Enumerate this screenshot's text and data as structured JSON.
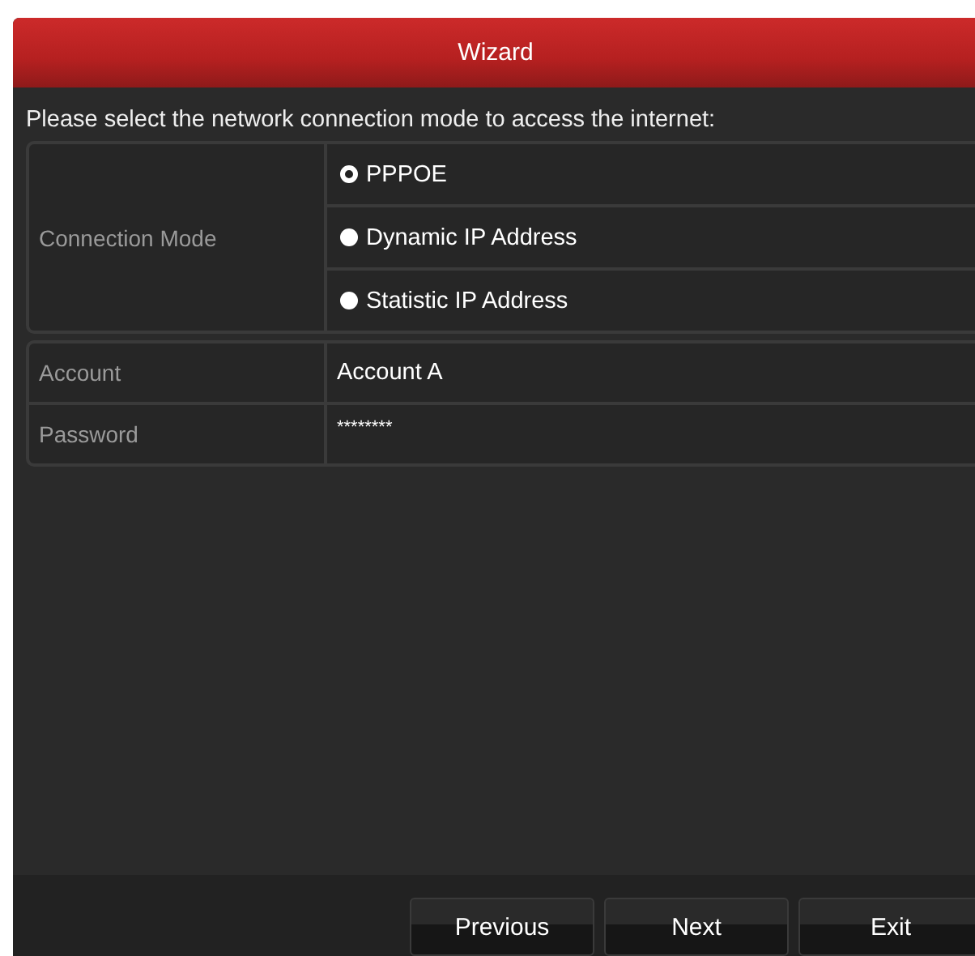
{
  "window": {
    "title": "Wizard"
  },
  "prompt": "Please select the network connection mode to access the internet:",
  "connection_mode": {
    "label": "Connection Mode",
    "options": [
      {
        "label": "PPPOE",
        "selected": true
      },
      {
        "label": "Dynamic IP Address",
        "selected": false
      },
      {
        "label": "Statistic IP Address",
        "selected": false
      }
    ]
  },
  "fields": [
    {
      "label": "Account",
      "value": "Account A"
    },
    {
      "label": "Password",
      "value": "********"
    }
  ],
  "buttons": [
    "Previous",
    "Next",
    "Exit"
  ]
}
